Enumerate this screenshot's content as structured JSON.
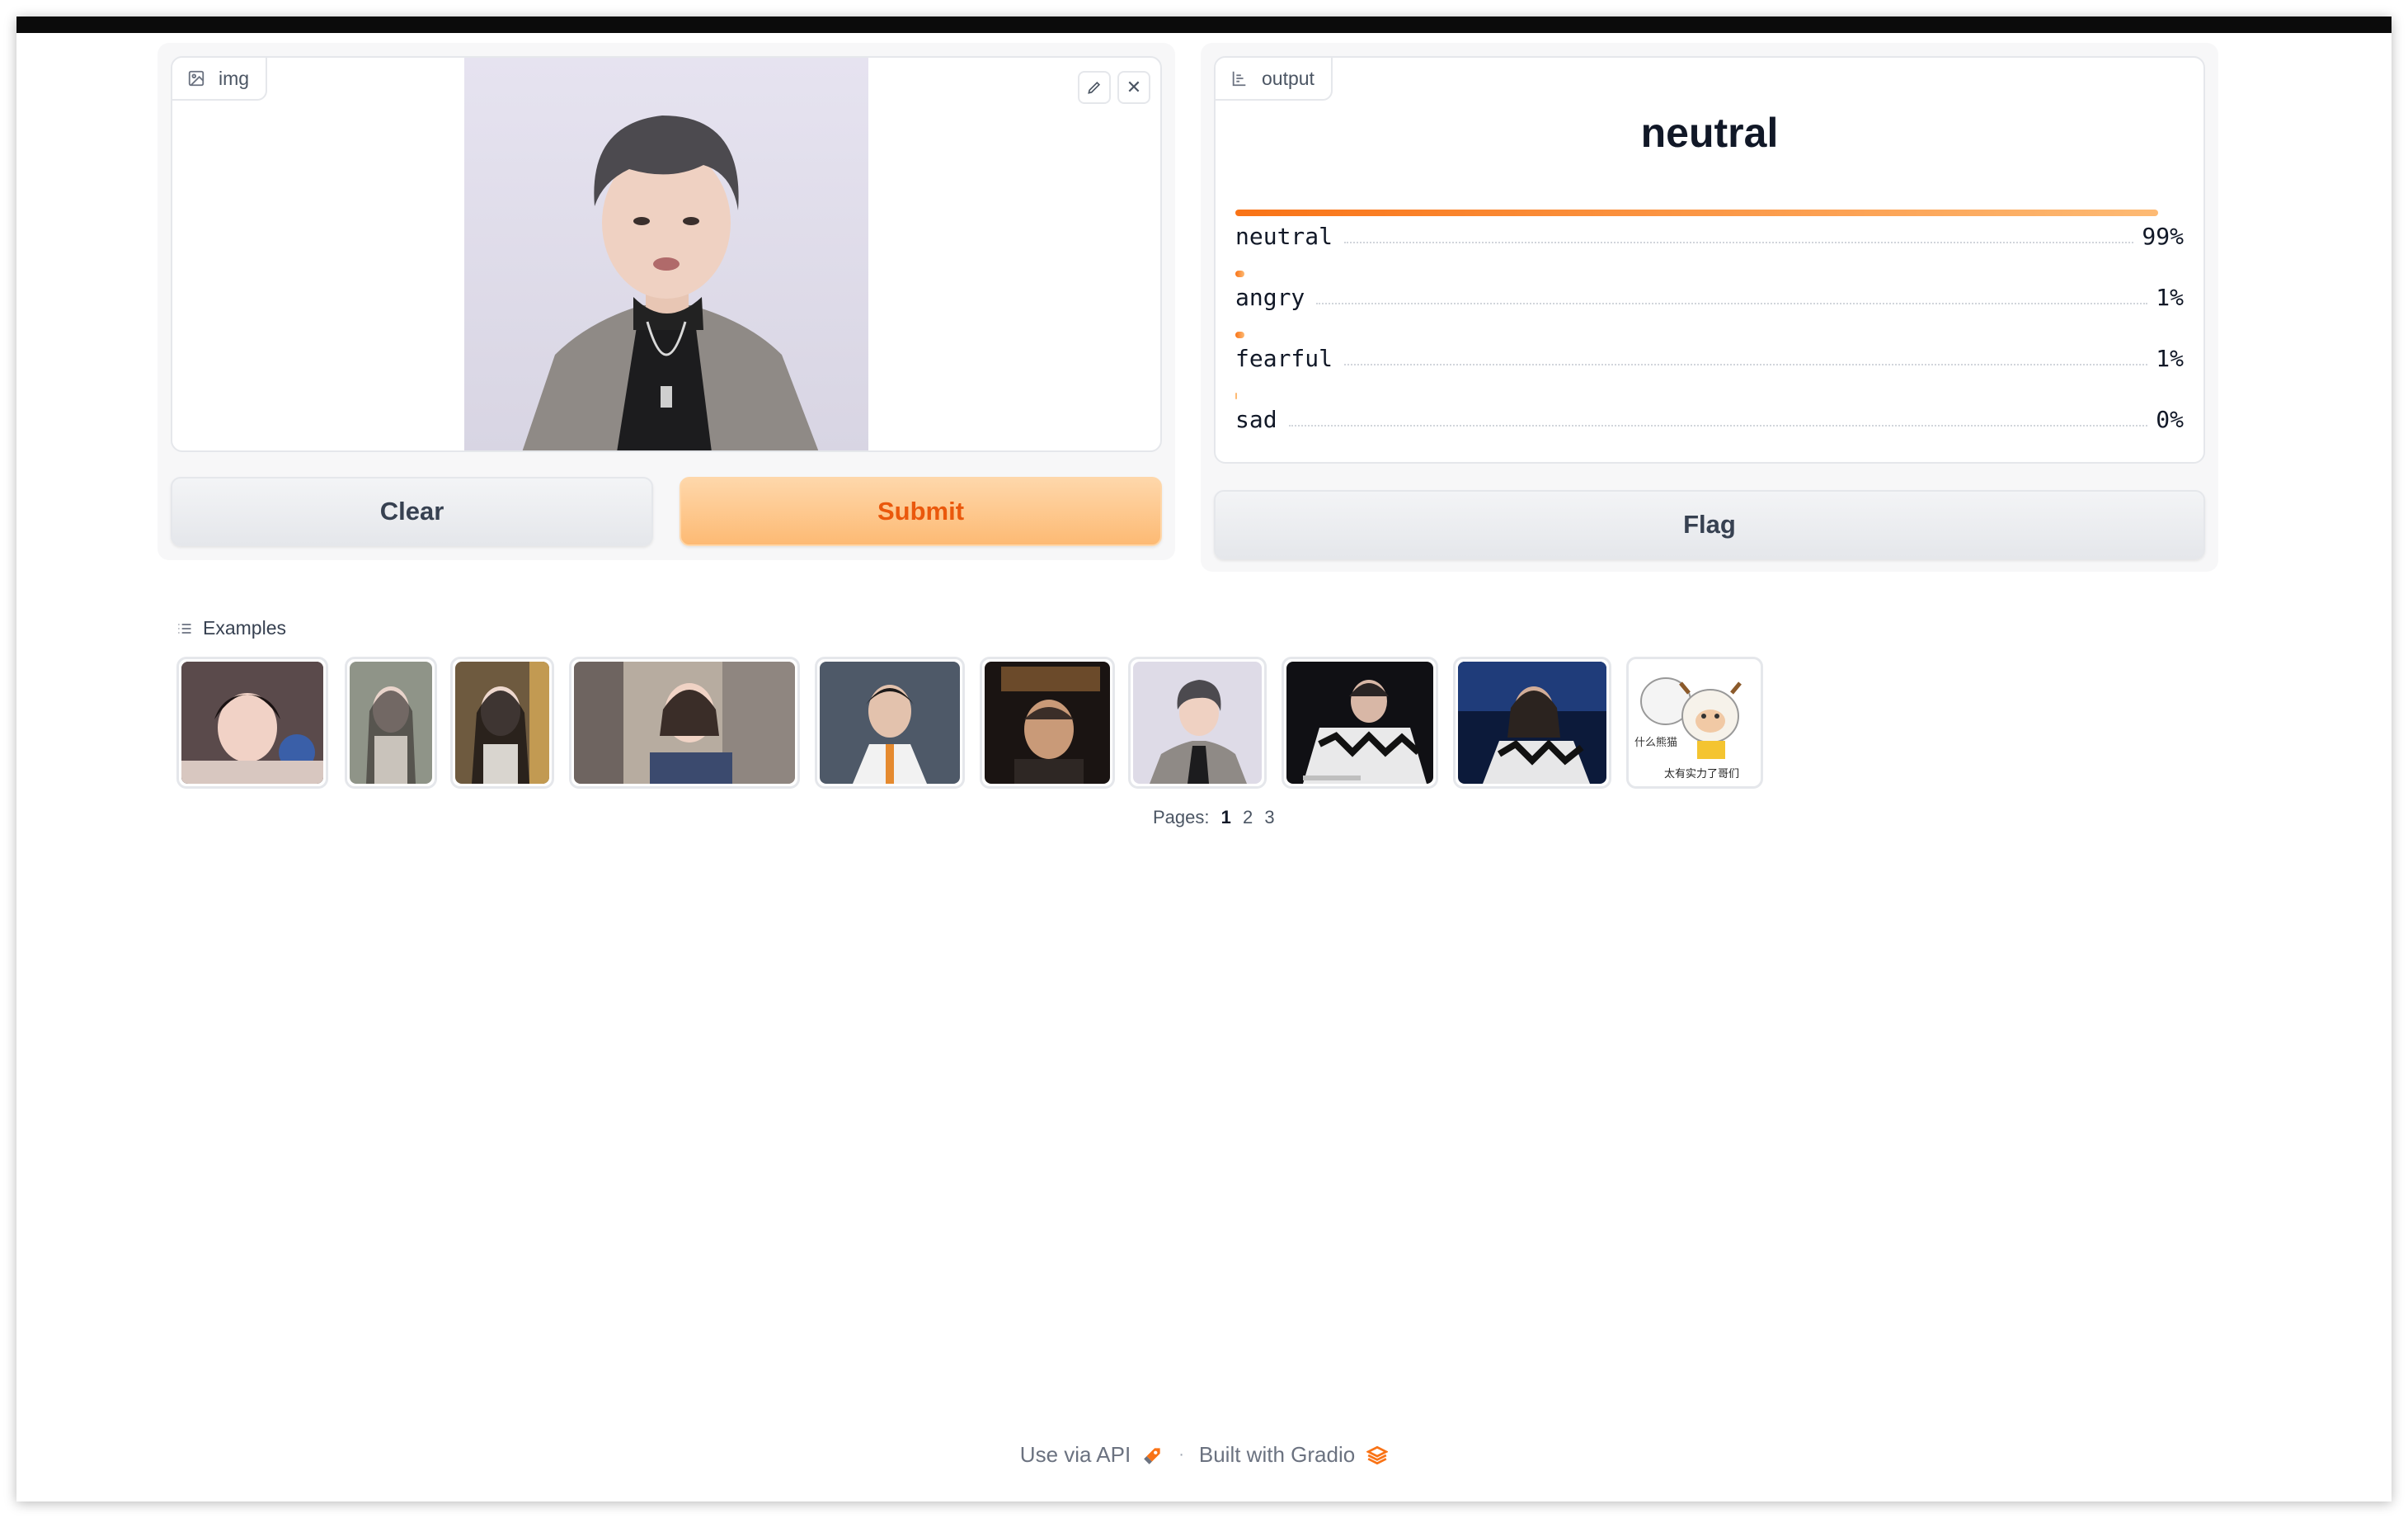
{
  "input": {
    "label": "img",
    "icon": "image-icon",
    "edit_icon": "pencil-icon",
    "remove_icon": "close-icon",
    "close_glyph": "✕"
  },
  "buttons": {
    "clear_label": "Clear",
    "submit_label": "Submit",
    "flag_label": "Flag"
  },
  "output": {
    "label": "output",
    "icon": "label-chart-icon",
    "top_label": "neutral",
    "confidences": [
      {
        "label": "neutral",
        "value": 0.99,
        "display": "99%"
      },
      {
        "label": "angry",
        "value": 0.01,
        "display": "1%"
      },
      {
        "label": "fearful",
        "value": 0.01,
        "display": "1%"
      },
      {
        "label": "sad",
        "value": 0.0,
        "display": "0%"
      }
    ]
  },
  "examples": {
    "heading": "Examples",
    "icon": "list-icon",
    "pages_label": "Pages:",
    "pages": [
      "1",
      "2",
      "3"
    ],
    "active_page": "1",
    "meme_top_text": "什么熊猫",
    "meme_bottom_text": "太有实力了哥们"
  },
  "footer": {
    "api_link": "Use via API",
    "api_icon": "rocket-icon",
    "separator": "·",
    "built_with": "Built with Gradio",
    "gradio_icon": "gradio-logo-icon"
  },
  "colors": {
    "accent": "#f97316",
    "accent_light": "#fdba74",
    "submit_text": "#ea580c"
  }
}
